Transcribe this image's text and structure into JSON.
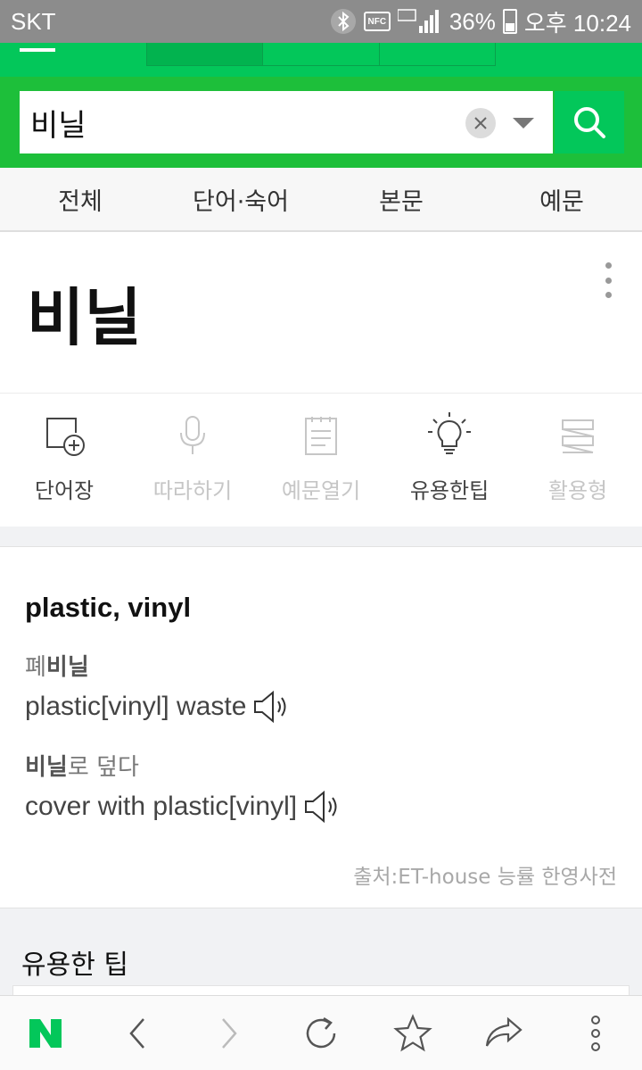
{
  "status_bar": {
    "carrier": "SKT",
    "nfc_label": "NFC",
    "battery": "36%",
    "time": "오후 10:24"
  },
  "search": {
    "query": "비닐"
  },
  "filter_tabs": [
    "전체",
    "단어·숙어",
    "본문",
    "예문"
  ],
  "entry": {
    "title": "비닐",
    "actions": [
      {
        "label": "단어장",
        "icon": "add-to-wordbook-icon",
        "enabled": true
      },
      {
        "label": "따라하기",
        "icon": "microphone-icon",
        "enabled": false
      },
      {
        "label": "예문열기",
        "icon": "document-icon",
        "enabled": false
      },
      {
        "label": "유용한팁",
        "icon": "lightbulb-icon",
        "enabled": true
      },
      {
        "label": "활용형",
        "icon": "layers-icon",
        "enabled": false
      }
    ]
  },
  "meaning": {
    "definition": "plastic, vinyl",
    "examples": [
      {
        "ko_pre": "폐",
        "ko_bold": "비닐",
        "ko_post": "",
        "en": "plastic[vinyl] waste"
      },
      {
        "ko_pre": "",
        "ko_bold": "비닐",
        "ko_post": "로 덮다",
        "en": "cover with plastic[vinyl]"
      }
    ],
    "source": "출처:ET-house 능률 한영사전"
  },
  "tips": {
    "title": "유용한 팁"
  },
  "bottom_nav": {
    "logo": "N",
    "items": [
      "naver-logo",
      "back-icon",
      "forward-icon",
      "refresh-icon",
      "star-icon",
      "share-icon",
      "more-vertical-icon"
    ]
  },
  "colors": {
    "brand_green": "#03c75a",
    "header_green": "#1dbf3a",
    "disabled_gray": "#c6c6c6"
  }
}
